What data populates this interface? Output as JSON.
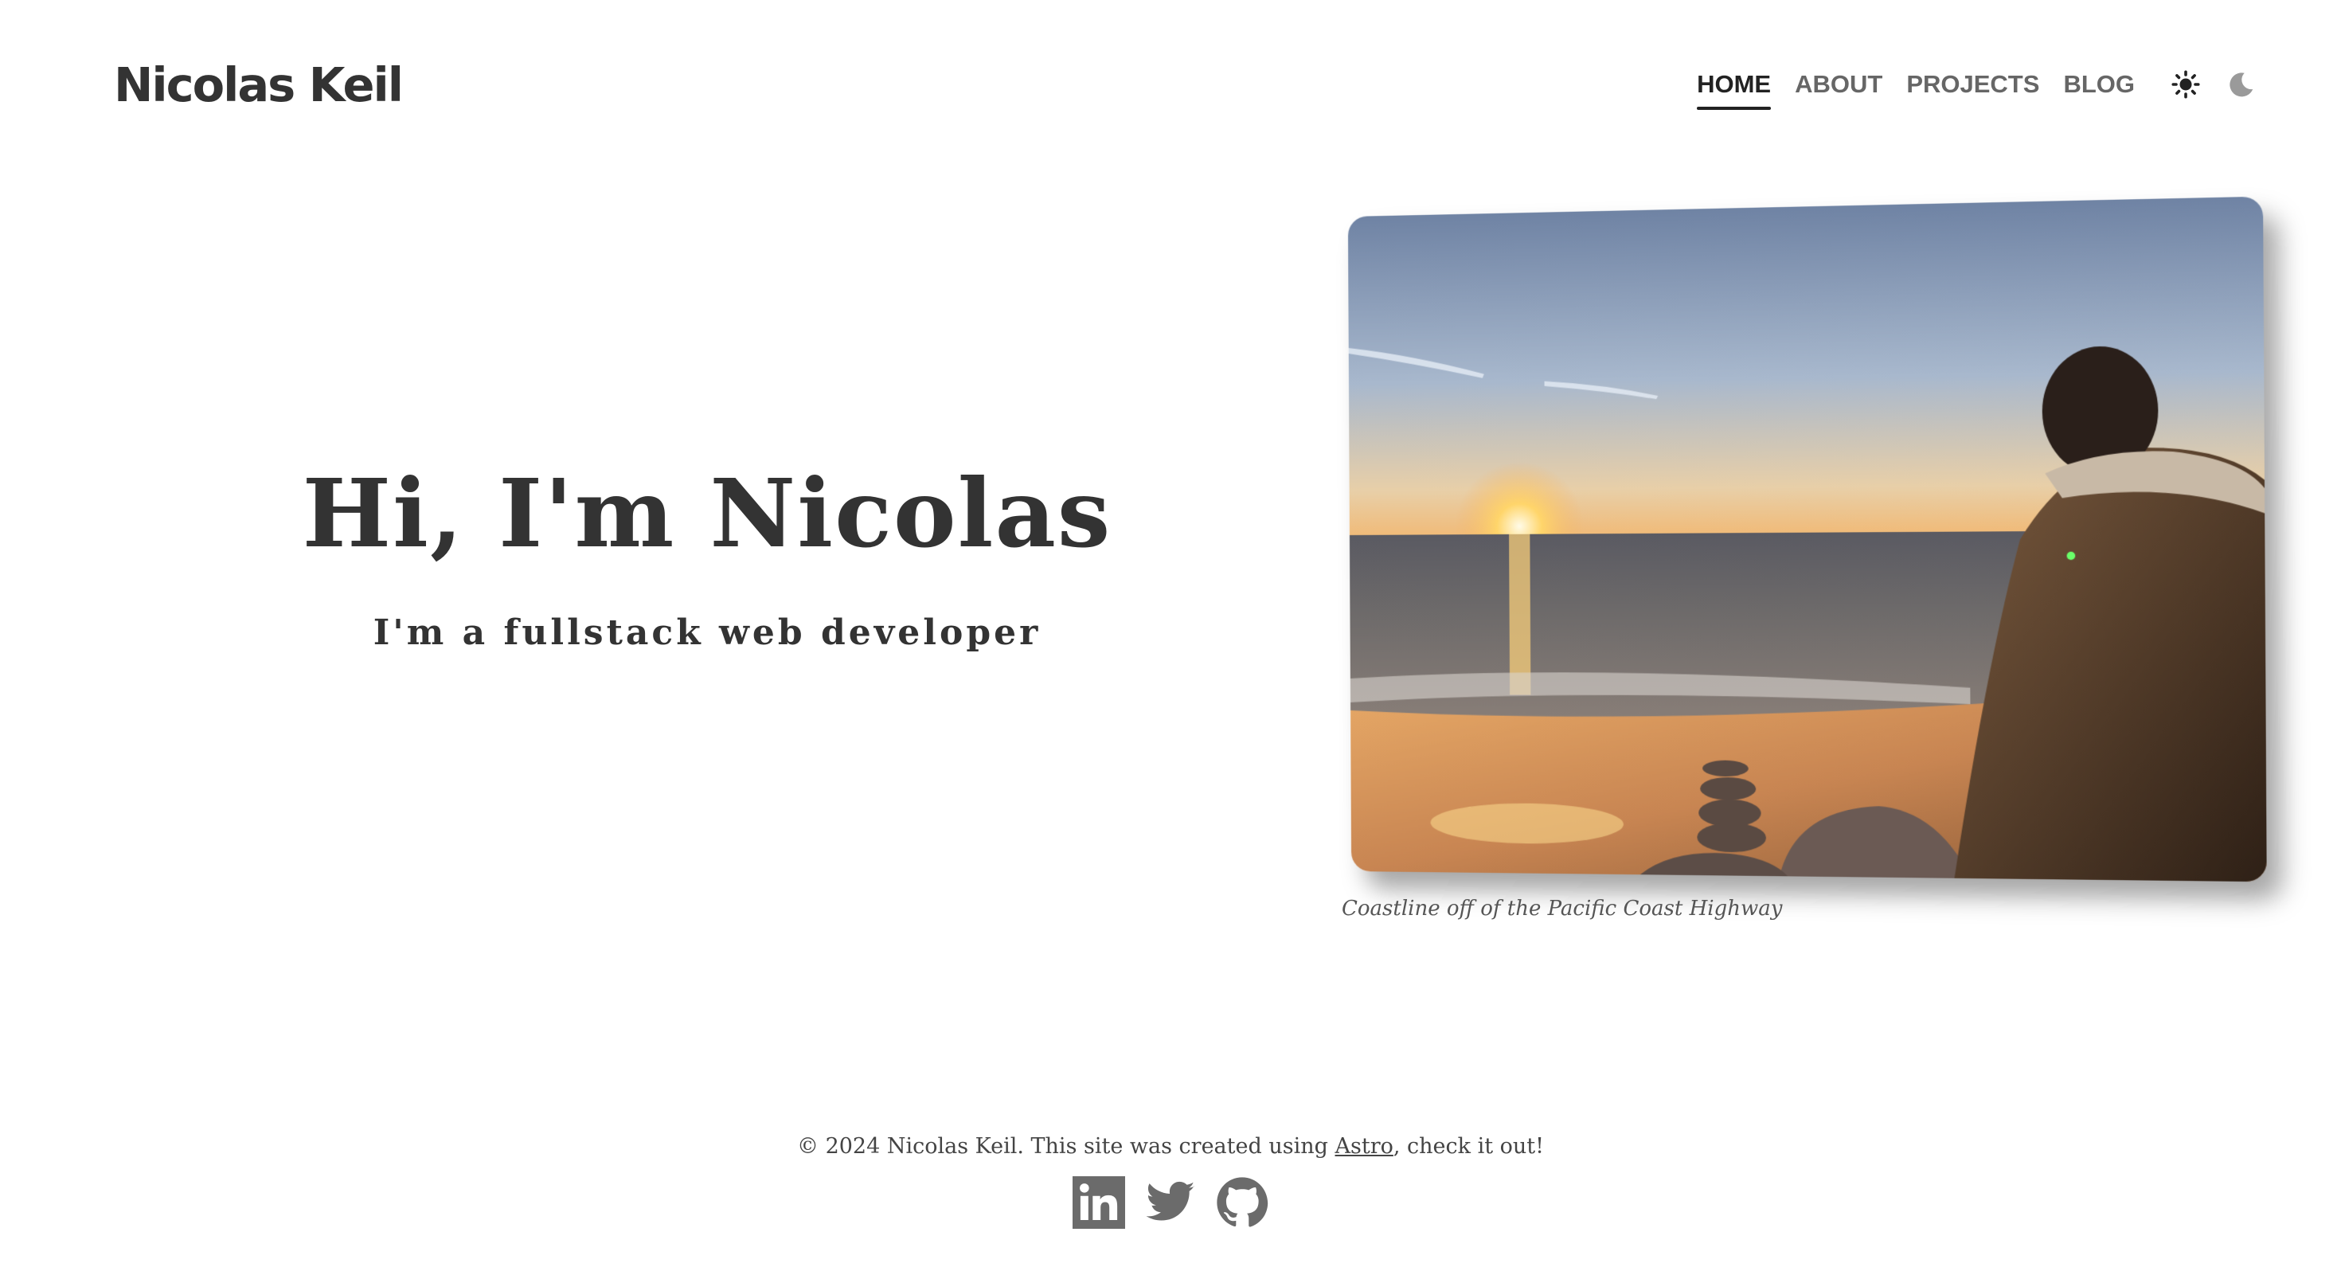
{
  "header": {
    "site_title": "Nicolas Keil"
  },
  "nav": {
    "items": [
      {
        "label": "HOME",
        "active": true
      },
      {
        "label": "ABOUT",
        "active": false
      },
      {
        "label": "PROJECTS",
        "active": false
      },
      {
        "label": "BLOG",
        "active": false
      }
    ],
    "theme_icons": [
      "sun-icon",
      "moon-icon"
    ]
  },
  "hero": {
    "heading": "Hi, I'm Nicolas",
    "subheading": "I'm a fullstack web developer",
    "image_caption": "Coastline off of the Pacific Coast Highway"
  },
  "footer": {
    "copyright_prefix": "© 2024 Nicolas Keil. This site was created using ",
    "link_label": "Astro",
    "copyright_suffix": ", check it out!",
    "social_icons": [
      "linkedin-icon",
      "twitter-icon",
      "github-icon"
    ]
  },
  "colors": {
    "text": "#333333",
    "nav_inactive": "#666666",
    "icon_gray": "#6b6b6b",
    "background": "#ffffff"
  }
}
